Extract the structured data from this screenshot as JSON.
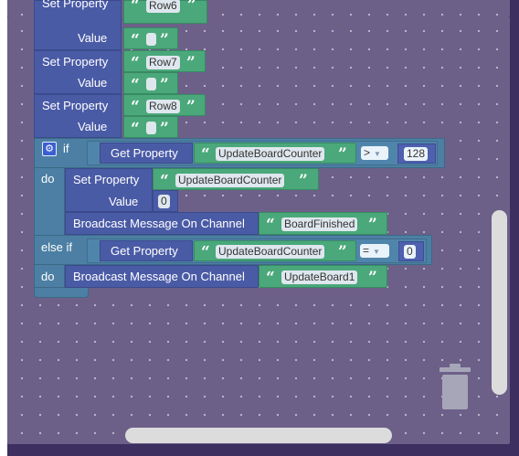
{
  "blocks": {
    "set_property_label": "Set Property",
    "value_label": "Value",
    "row6": "Row6",
    "row7": "Row7",
    "row8": "Row8",
    "if_label": "if",
    "do_label": "do",
    "else_if_label": "else if",
    "get_property_label": "Get Property",
    "update_board_counter": "UpdateBoardCounter",
    "op_greater": ">",
    "num_128": "128",
    "num_0_value": "0",
    "broadcast_label": "Broadcast Message On Channel",
    "board_finished": "BoardFinished",
    "op_equal": "=",
    "num_0_compare": "0",
    "update_board1": "UpdateBoard1"
  },
  "icons": {
    "gear": "gear-icon",
    "trash": "trash-icon"
  },
  "colors": {
    "workspace": "#6c6089",
    "set_property": "#4a5ba6",
    "control": "#4c7fa3",
    "text_block": "#4aa87a"
  }
}
